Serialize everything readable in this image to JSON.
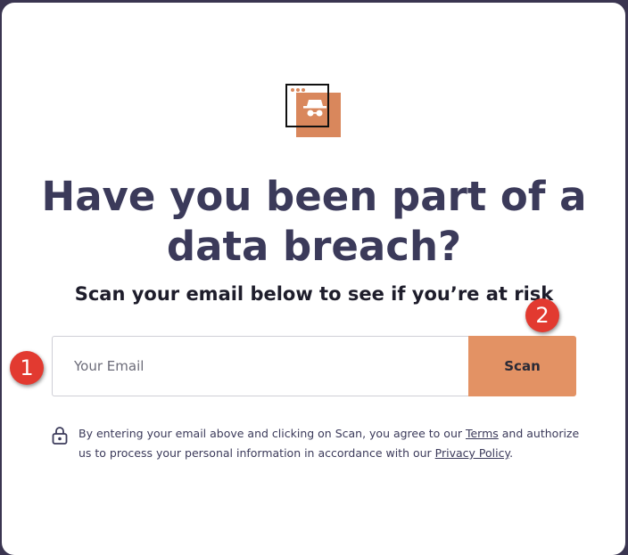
{
  "hero": {
    "title_line1": "Have you been part of a",
    "title_line2": "data breach?",
    "subtitle": "Scan your email below to see if you’re at risk"
  },
  "form": {
    "email_placeholder": "Your Email",
    "email_value": "",
    "scan_label": "Scan"
  },
  "annotations": {
    "badge_1": "1",
    "badge_2": "2"
  },
  "disclaimer": {
    "text_before_terms": "By entering your email above and clicking on Scan, you agree to our ",
    "terms_link": "Terms",
    "text_middle": " and authorize us to process your personal information in accordance with our ",
    "privacy_link": "Privacy Policy",
    "text_end": "."
  },
  "icons": {
    "logo": "incognito-spy-icon",
    "lock": "lock-icon"
  },
  "colors": {
    "accent": "#e39264",
    "title": "#3b3a5a",
    "badge": "#e23a30"
  }
}
